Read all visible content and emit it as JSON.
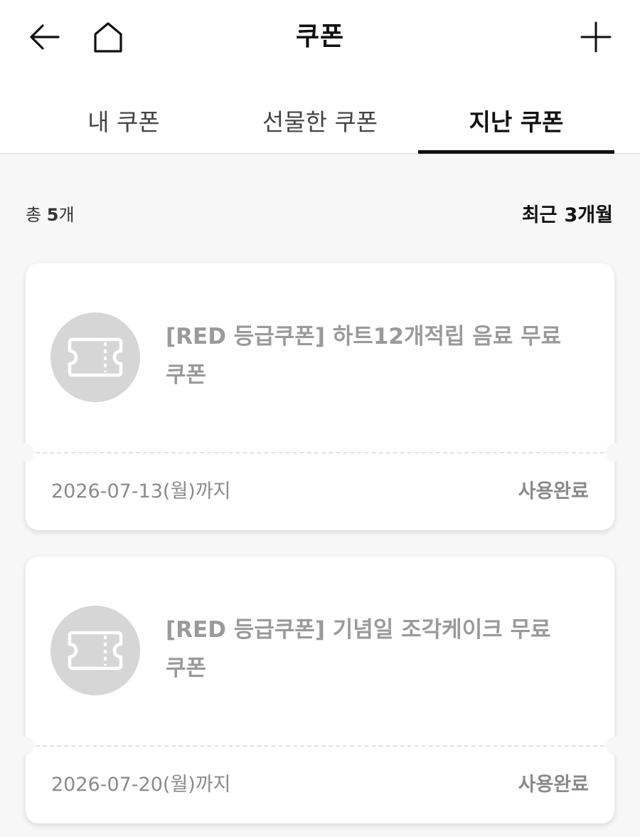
{
  "header": {
    "title": "쿠폰",
    "back_icon": "arrow-left-icon",
    "home_icon": "home-icon",
    "add_icon": "plus-icon"
  },
  "tabs": [
    {
      "label": "내 쿠폰",
      "active": false
    },
    {
      "label": "선물한 쿠폰",
      "active": false
    },
    {
      "label": "지난 쿠폰",
      "active": true
    }
  ],
  "summary": {
    "total_prefix": "총",
    "total_count": "5",
    "total_suffix": "개",
    "period_label": "최근",
    "period_value": "3개월"
  },
  "coupons": [
    {
      "icon": "ticket-icon",
      "name": "[RED 등급쿠폰] 하트12개적립 음료 무료 쿠폰",
      "expiry": "2026-07-13(월)까지",
      "status": "사용완료"
    },
    {
      "icon": "ticket-icon",
      "name": "[RED 등급쿠폰] 기념일 조각케이크 무료 쿠폰",
      "expiry": "2026-07-20(월)까지",
      "status": "사용완료"
    }
  ],
  "colors": {
    "active_tab_underline": "#111111",
    "muted_text": "#9a9a9a",
    "icon_circle": "#d6d6d6",
    "page_background": "#f7f7f7"
  }
}
